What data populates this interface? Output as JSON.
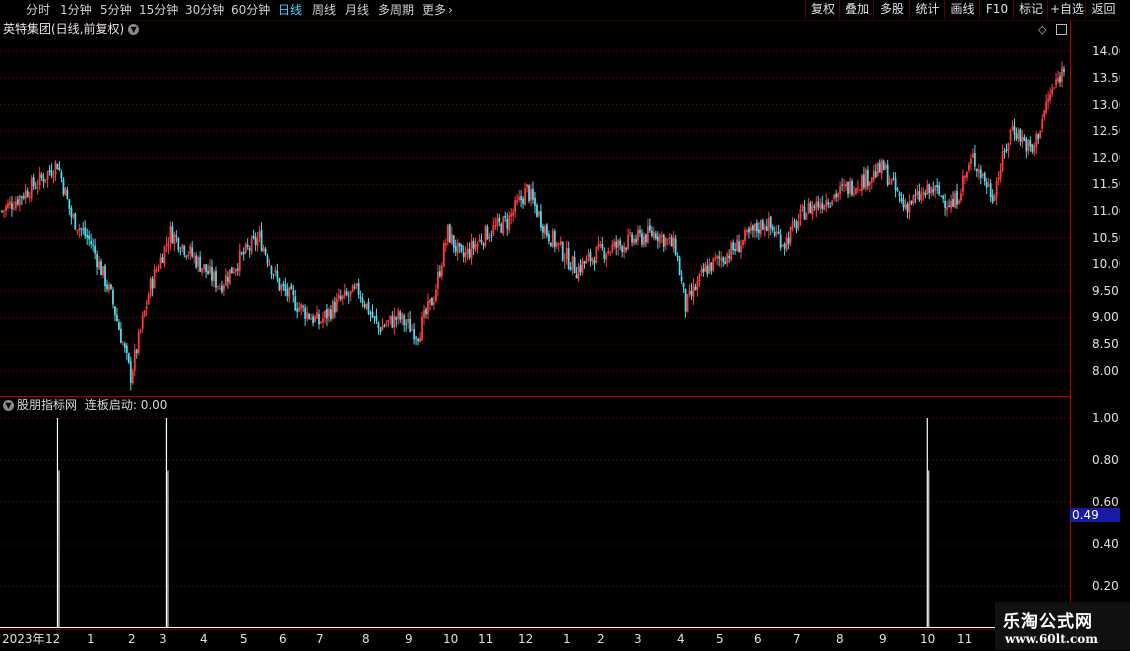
{
  "toolbar": {
    "periods": [
      "分时",
      "1分钟",
      "5分钟",
      "15分钟",
      "30分钟",
      "60分钟",
      "日线",
      "周线",
      "月线",
      "多周期"
    ],
    "active_period": "日线",
    "more_label": "更多",
    "more_arrow": "›",
    "buttons": [
      "复权",
      "叠加",
      "多股",
      "统计",
      "画线",
      "F10",
      "标记",
      "+自选",
      "返回"
    ]
  },
  "stock": {
    "title": "英特集团(日线,前复权)",
    "dropdown_icon": "chevron-down-icon"
  },
  "indicator": {
    "source": "股朋指标网",
    "name_value": "连板启动: 0.00"
  },
  "price_axis": [
    "14.00",
    "13.50",
    "13.00",
    "12.50",
    "12.00",
    "11.50",
    "11.00",
    "10.50",
    "10.00",
    "9.50",
    "9.00",
    "8.50",
    "8.00"
  ],
  "indicator_axis": [
    "1.00",
    "0.80",
    "0.60",
    "0.40",
    "0.20"
  ],
  "cursor_value": "0.49",
  "time_axis": [
    "2023年",
    "12",
    "1",
    "2",
    "3",
    "4",
    "5",
    "6",
    "7",
    "8",
    "9",
    "10",
    "11",
    "12",
    "1",
    "2",
    "3",
    "4",
    "5",
    "6",
    "7",
    "8",
    "9",
    "10",
    "11"
  ],
  "watermark": {
    "title": "乐淘公式网",
    "url": "www.60lt.com"
  },
  "colors": {
    "up": "#ff3c3c",
    "down": "#54d8e8",
    "grid": "#8a0000",
    "axis": "#b00000",
    "signal": "#ffffff"
  },
  "chart_data": {
    "type": "candlestick",
    "title": "英特集团(日线,前复权)",
    "ylim": [
      7.6,
      14.4
    ],
    "indicator": {
      "name": "连板启动",
      "ylim": [
        0,
        1.0
      ],
      "signals_at_index": [
        28,
        83,
        467
      ],
      "signal_value": 1.0
    }
  }
}
